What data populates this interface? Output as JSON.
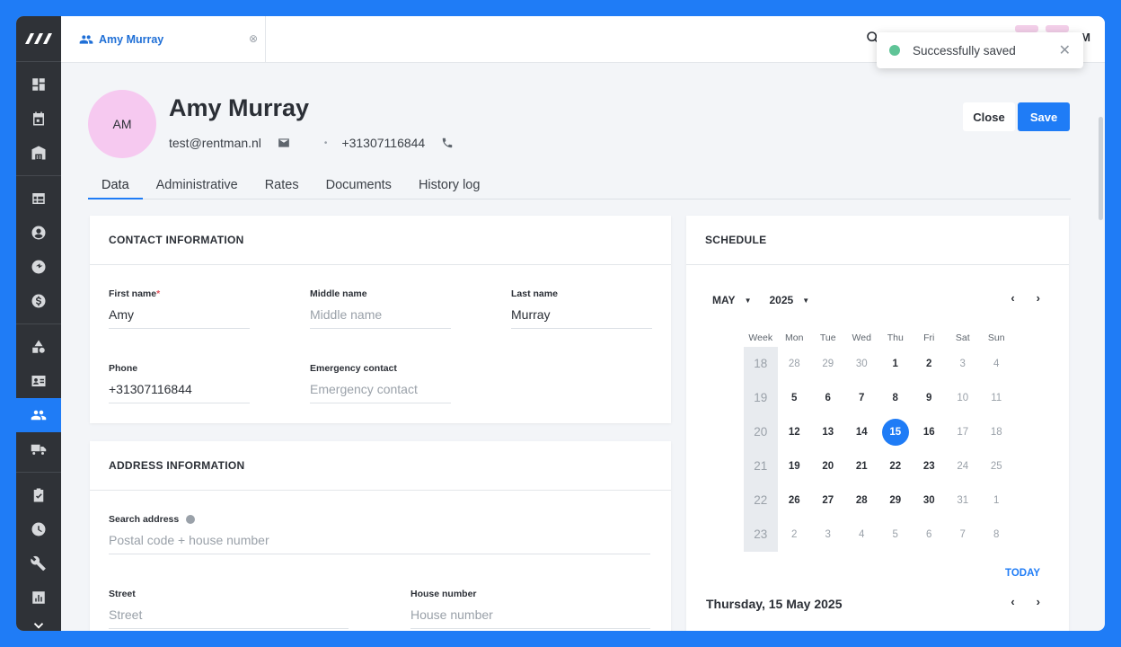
{
  "window": {
    "accent": "#1f7cf6"
  },
  "sidebar": {
    "logo": "rentman-logo",
    "items": [
      {
        "icon": "dashboard-icon"
      },
      {
        "icon": "calendar-icon"
      },
      {
        "icon": "warehouse-icon"
      },
      {
        "icon": "table-icon"
      },
      {
        "icon": "account-icon"
      },
      {
        "icon": "crew-icon"
      },
      {
        "icon": "dollar-icon"
      },
      {
        "icon": "shapes-icon"
      },
      {
        "icon": "contact-card-icon"
      },
      {
        "icon": "people-icon",
        "active": true
      },
      {
        "icon": "truck-icon"
      },
      {
        "icon": "checklist-icon"
      },
      {
        "icon": "clock-icon"
      },
      {
        "icon": "wrench-icon"
      },
      {
        "icon": "report-icon"
      },
      {
        "icon": "chevron-down-icon"
      }
    ]
  },
  "topbar": {
    "tab_label": "Amy Murray",
    "tab_close": "⊗",
    "avatar_initial": "M"
  },
  "toast": {
    "text": "Successfully saved",
    "close": "✕"
  },
  "profile": {
    "initials": "AM",
    "name": "Amy Murray",
    "email": "test@rentman.nl",
    "separator": "•",
    "phone": "+31307116844",
    "close_label": "Close",
    "save_label": "Save"
  },
  "tabs": [
    {
      "label": "Data",
      "active": true
    },
    {
      "label": "Administrative"
    },
    {
      "label": "Rates"
    },
    {
      "label": "Documents"
    },
    {
      "label": "History log"
    }
  ],
  "contact": {
    "title": "CONTACT INFORMATION",
    "first_name": {
      "label": "First name",
      "required": "*",
      "value": "Amy"
    },
    "middle_name": {
      "label": "Middle name",
      "placeholder": "Middle name"
    },
    "last_name": {
      "label": "Last name",
      "value": "Murray"
    },
    "phone": {
      "label": "Phone",
      "value": "+31307116844"
    },
    "emergency": {
      "label": "Emergency contact",
      "placeholder": "Emergency contact"
    }
  },
  "address": {
    "title": "ADDRESS INFORMATION",
    "search": {
      "label": "Search address",
      "placeholder": "Postal code + house number"
    },
    "street": {
      "label": "Street",
      "placeholder": "Street"
    },
    "house_number": {
      "label": "House number",
      "placeholder": "House number"
    }
  },
  "schedule": {
    "title": "SCHEDULE",
    "month": "MAY",
    "year": "2025",
    "prev": "‹",
    "next": "›",
    "headers": [
      "Week",
      "Mon",
      "Tue",
      "Wed",
      "Thu",
      "Fri",
      "Sat",
      "Sun"
    ],
    "weeks": [
      {
        "week": "18",
        "days": [
          "28",
          "29",
          "30",
          "1",
          "2",
          "3",
          "4"
        ]
      },
      {
        "week": "19",
        "days": [
          "5",
          "6",
          "7",
          "8",
          "9",
          "10",
          "11"
        ]
      },
      {
        "week": "20",
        "days": [
          "12",
          "13",
          "14",
          "15",
          "16",
          "17",
          "18"
        ]
      },
      {
        "week": "21",
        "days": [
          "19",
          "20",
          "21",
          "22",
          "23",
          "24",
          "25"
        ]
      },
      {
        "week": "22",
        "days": [
          "26",
          "27",
          "28",
          "29",
          "30",
          "31",
          "1"
        ]
      },
      {
        "week": "23",
        "days": [
          "2",
          "3",
          "4",
          "5",
          "6",
          "7",
          "8"
        ]
      }
    ],
    "selected_day": "15",
    "today_label": "TODAY",
    "date_line": "Thursday, 15 May 2025"
  }
}
